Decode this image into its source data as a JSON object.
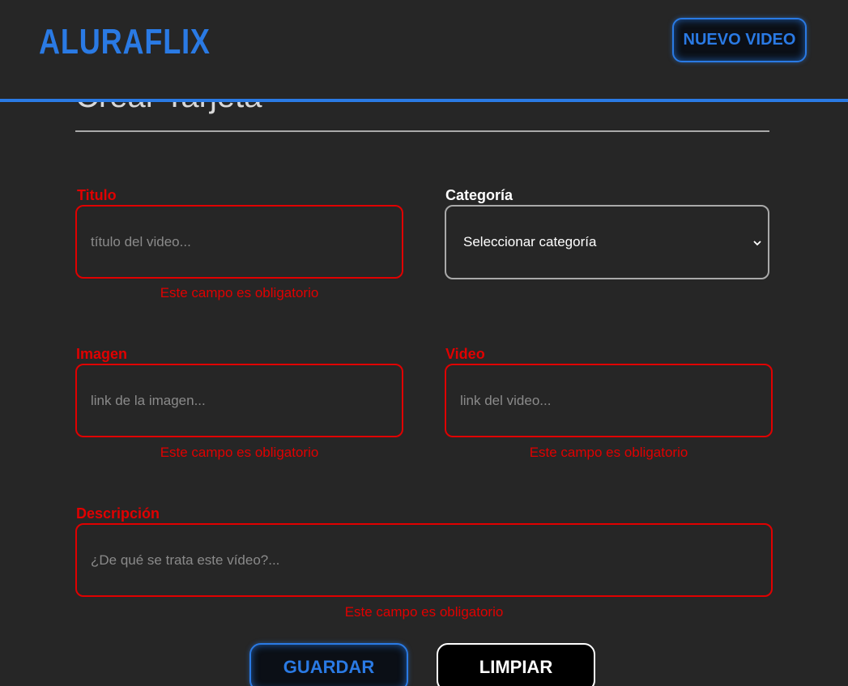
{
  "header": {
    "logo": "ALURAFLIX",
    "new_video_label": "NUEVO VIDEO"
  },
  "form": {
    "title": "Crear Tarjeta",
    "titulo": {
      "label": "Titulo",
      "placeholder": "título del video...",
      "error": "Este campo es obligatorio"
    },
    "categoria": {
      "label": "Categoría",
      "selected": "Seleccionar categoría"
    },
    "imagen": {
      "label": "Imagen",
      "placeholder": "link de la imagen...",
      "error": "Este campo es obligatorio"
    },
    "video": {
      "label": "Video",
      "placeholder": "link del video...",
      "error": "Este campo es obligatorio"
    },
    "descripcion": {
      "label": "Descripción",
      "placeholder": "¿De qué se trata este vídeo?...",
      "error": "Este campo es obligatorio"
    },
    "save_label": "GUARDAR",
    "clear_label": "LIMPIAR"
  },
  "colors": {
    "accent": "#2a7ae4",
    "error": "#e00000",
    "background": "#262626"
  }
}
